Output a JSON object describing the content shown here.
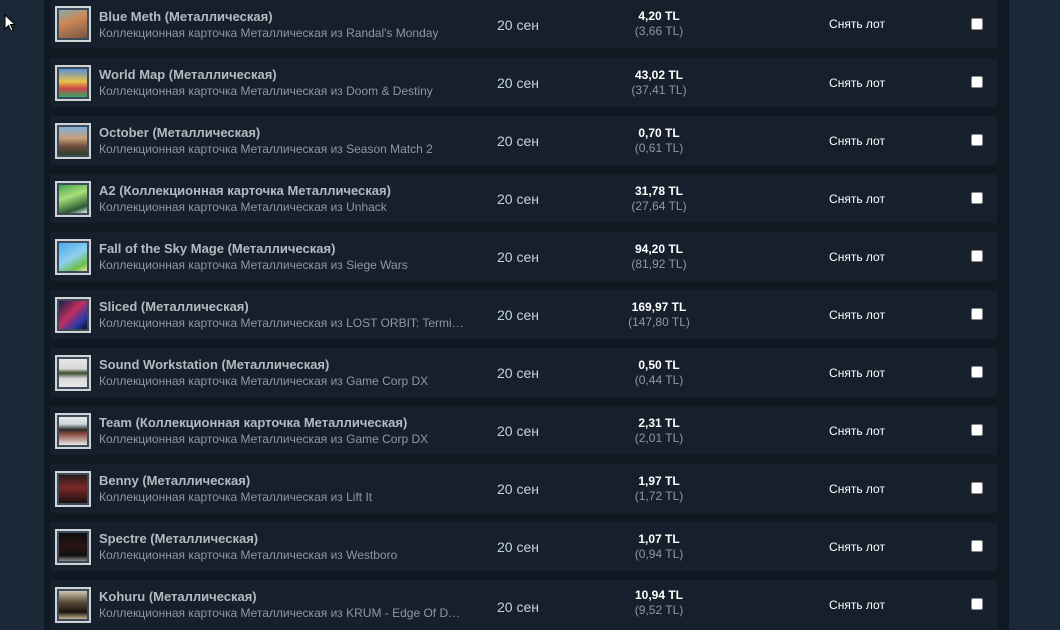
{
  "listings": [
    {
      "name": "Blue Meth (Металлическая)",
      "subtitle": "Коллекционная карточка Металлическая из Randal's Monday",
      "date": "20 сен",
      "price": "4,20 TL",
      "price_net": "(3,66 TL)",
      "remove_label": "Снять лот",
      "checked": false,
      "icon": "card-thumbnail-icon"
    },
    {
      "name": "World Map (Металлическая)",
      "subtitle": "Коллекционная карточка Металлическая из Doom & Destiny",
      "date": "20 сен",
      "price": "43,02 TL",
      "price_net": "(37,41 TL)",
      "remove_label": "Снять лот",
      "checked": false,
      "icon": "card-thumbnail-icon"
    },
    {
      "name": "October (Металлическая)",
      "subtitle": "Коллекционная карточка Металлическая из Season Match 2",
      "date": "20 сен",
      "price": "0,70 TL",
      "price_net": "(0,61 TL)",
      "remove_label": "Снять лот",
      "checked": false,
      "icon": "card-thumbnail-icon"
    },
    {
      "name": "A2 (Коллекционная карточка Металлическая)",
      "subtitle": "Коллекционная карточка Металлическая из Unhack",
      "date": "20 сен",
      "price": "31,78 TL",
      "price_net": "(27,64 TL)",
      "remove_label": "Снять лот",
      "checked": false,
      "icon": "card-thumbnail-icon"
    },
    {
      "name": "Fall of the Sky Mage (Металлическая)",
      "subtitle": "Коллекционная карточка Металлическая из Siege Wars",
      "date": "20 сен",
      "price": "94,20 TL",
      "price_net": "(81,92 TL)",
      "remove_label": "Снять лот",
      "checked": false,
      "icon": "card-thumbnail-icon"
    },
    {
      "name": "Sliced (Металлическая)",
      "subtitle": "Коллекционная карточка Металлическая из LOST ORBIT: Terminal Velocity",
      "date": "20 сен",
      "price": "169,97 TL",
      "price_net": "(147,80 TL)",
      "remove_label": "Снять лот",
      "checked": false,
      "icon": "card-thumbnail-icon"
    },
    {
      "name": "Sound Workstation (Металлическая)",
      "subtitle": "Коллекционная карточка Металлическая из Game Corp DX",
      "date": "20 сен",
      "price": "0,50 TL",
      "price_net": "(0,44 TL)",
      "remove_label": "Снять лот",
      "checked": false,
      "icon": "card-thumbnail-icon"
    },
    {
      "name": "Team (Коллекционная карточка Металлическая)",
      "subtitle": "Коллекционная карточка Металлическая из Game Corp DX",
      "date": "20 сен",
      "price": "2,31 TL",
      "price_net": "(2,01 TL)",
      "remove_label": "Снять лот",
      "checked": false,
      "icon": "card-thumbnail-icon"
    },
    {
      "name": "Benny (Металлическая)",
      "subtitle": "Коллекционная карточка Металлическая из Lift It",
      "date": "20 сен",
      "price": "1,97 TL",
      "price_net": "(1,72 TL)",
      "remove_label": "Снять лот",
      "checked": false,
      "icon": "card-thumbnail-icon"
    },
    {
      "name": "Spectre (Металлическая)",
      "subtitle": "Коллекционная карточка Металлическая из Westboro",
      "date": "20 сен",
      "price": "1,07 TL",
      "price_net": "(0,94 TL)",
      "remove_label": "Снять лот",
      "checked": false,
      "icon": "card-thumbnail-icon"
    },
    {
      "name": "Kohuru (Металлическая)",
      "subtitle": "Коллекционная карточка Металлическая из KRUM - Edge Of Darkness",
      "date": "20 сен",
      "price": "10,94 TL",
      "price_net": "(9,52 TL)",
      "remove_label": "Снять лот",
      "checked": false,
      "icon": "card-thumbnail-icon"
    }
  ],
  "colors": {
    "background": "#1b2838",
    "row": "#16202d",
    "name_text": "#b4bac0",
    "sub_text": "#8f98a0"
  }
}
